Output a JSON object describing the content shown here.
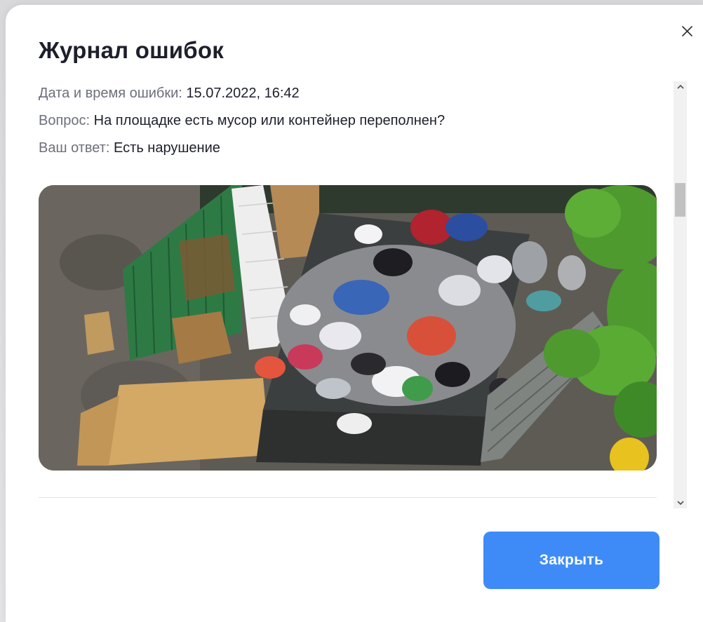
{
  "dialog": {
    "title": "Журнал ошибок",
    "close_icon": "close-icon"
  },
  "details": {
    "datetime_label": "Дата и время ошибки:",
    "datetime_value": "15.07.2022, 16:42",
    "question_label": "Вопрос:",
    "question_value": "На площадке есть мусор или контейнер переполнен?",
    "answer_label": "Ваш ответ:",
    "answer_value": "Есть нарушение"
  },
  "photo": {
    "alt": "Фото площадки"
  },
  "scrollbar": {
    "up_icon": "chevron-up-icon",
    "down_icon": "chevron-down-icon"
  },
  "footer": {
    "close_label": "Закрыть"
  },
  "colors": {
    "accent": "#3e8bf8",
    "title": "#1d1f2c",
    "label": "#6d6f7b"
  }
}
